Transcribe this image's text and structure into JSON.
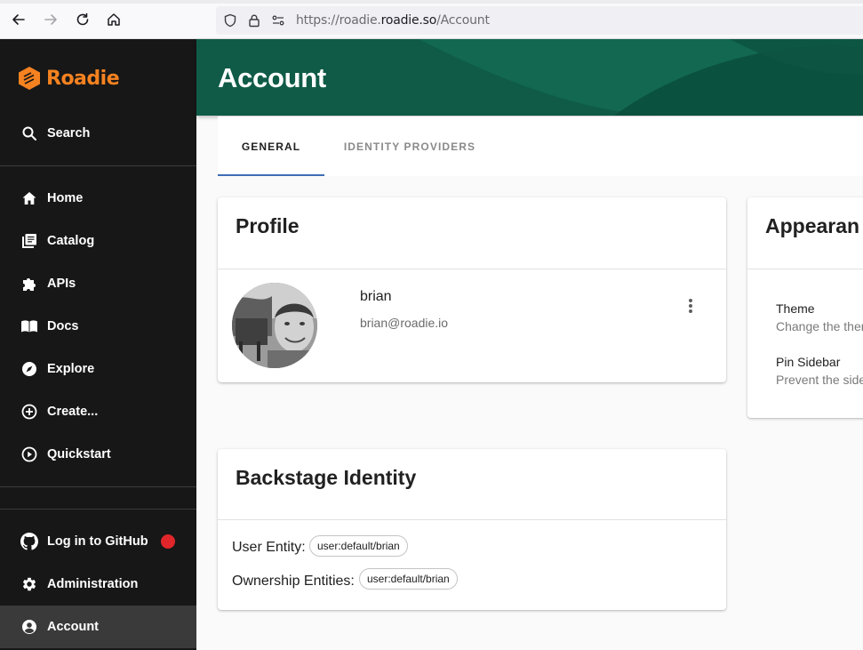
{
  "browser": {
    "url_prefix": "https://roadie.",
    "url_domain": "roadie.so",
    "url_path": "/Account"
  },
  "sidebar": {
    "brand": "Roadie",
    "search_label": "Search",
    "items": [
      {
        "label": "Home",
        "icon": "home-icon"
      },
      {
        "label": "Catalog",
        "icon": "catalog-icon"
      },
      {
        "label": "APIs",
        "icon": "puzzle-icon"
      },
      {
        "label": "Docs",
        "icon": "book-icon"
      },
      {
        "label": "Explore",
        "icon": "compass-icon"
      },
      {
        "label": "Create...",
        "icon": "add-circle-icon"
      },
      {
        "label": "Quickstart",
        "icon": "play-circle-icon"
      }
    ],
    "bottom_items": [
      {
        "label": "Log in to GitHub",
        "icon": "github-icon"
      },
      {
        "label": "Administration",
        "icon": "gear-icon"
      },
      {
        "label": "Account",
        "icon": "account-circle-icon"
      }
    ],
    "accent_color": "#f58220",
    "status_dot_color": "#e0262a"
  },
  "header": {
    "title": "Account",
    "color": "#0f5b47"
  },
  "tabs": [
    {
      "label": "GENERAL",
      "active": true
    },
    {
      "label": "IDENTITY PROVIDERS",
      "active": false
    }
  ],
  "profile": {
    "title": "Profile",
    "name": "brian",
    "email": "brian@roadie.io"
  },
  "appearance": {
    "title": "Appearan",
    "theme_label": "Theme",
    "theme_desc": "Change the ther",
    "pin_label": "Pin Sidebar",
    "pin_desc": "Prevent the side"
  },
  "identity": {
    "title": "Backstage Identity",
    "user_entity_label": "User Entity:",
    "user_entity_value": "user:default/brian",
    "ownership_label": "Ownership Entities:",
    "ownership_value": "user:default/brian"
  }
}
